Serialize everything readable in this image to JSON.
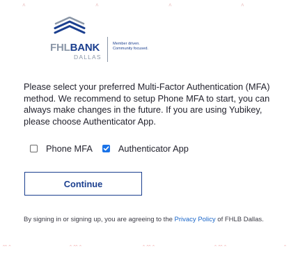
{
  "logo": {
    "brand_prefix": "FHL",
    "brand_bank": "BANK",
    "brand_location": "DALLAS",
    "tagline_line1": "Member driven.",
    "tagline_line2": "Community focused.",
    "alt": "FHLBank Dallas logo",
    "icon": "building-roof-icon",
    "colors": {
      "navy": "#1b3f8f",
      "gray": "#8a96a7"
    }
  },
  "instructions": "Please select your preferred Multi-Factor Authentication (MFA) method. We recommend to setup Phone MFA to start, you can always make changes in the future. If you are using Yubikey, please choose Authenticator App.",
  "mfa_options": [
    {
      "label": "Phone MFA",
      "checked": false
    },
    {
      "label": "Authenticator App",
      "checked": true
    }
  ],
  "continue_label": "Continue",
  "legal": {
    "prefix": "By signing in or signing up, you are agreeing to the ",
    "link_text": "Privacy Policy",
    "suffix": " of FHLB Dallas."
  },
  "colors": {
    "accent": "#1b3f8f",
    "link": "#1a66c9",
    "checkbox_checked": "#1a73e8",
    "text": "#23232e"
  }
}
